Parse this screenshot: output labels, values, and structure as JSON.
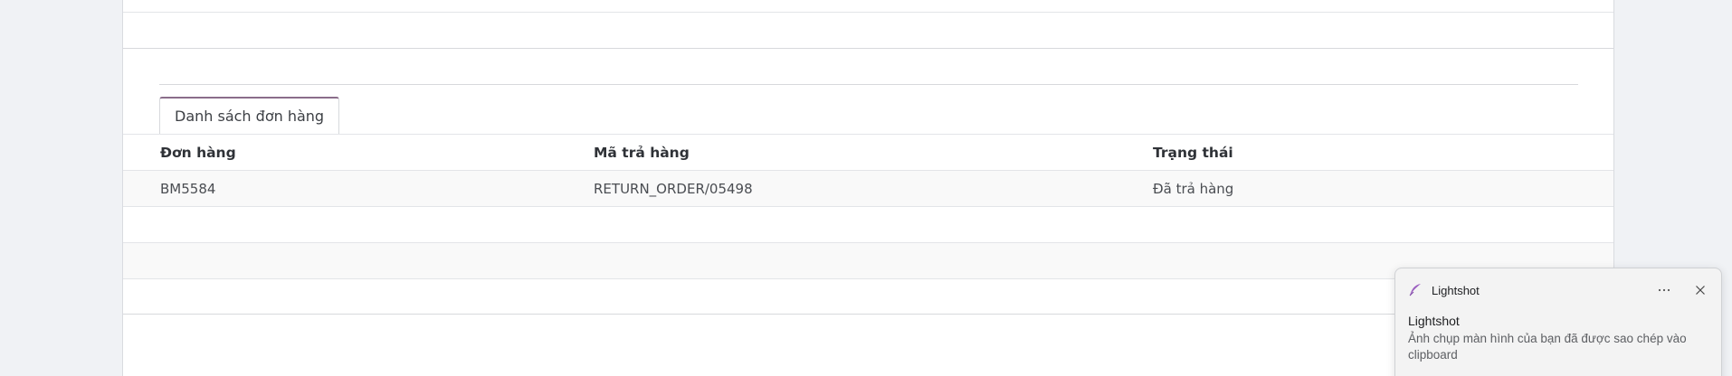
{
  "tabs": {
    "orders_tab": "Danh sách đơn hàng"
  },
  "table": {
    "headers": [
      "Đơn hàng",
      "Mã trả hàng",
      "Trạng thái"
    ],
    "rows": [
      [
        "BM5584",
        "RETURN_ORDER/05498",
        "Đã trả hàng"
      ]
    ]
  },
  "notification": {
    "app_name": "Lightshot",
    "title": "Lightshot",
    "message": "Ảnh chụp màn hình của bạn đã được sao chép vào clipboard",
    "more_icon": "ellipsis-icon",
    "close_icon": "close-icon",
    "accent_color": "#9b5fc0"
  },
  "colors": {
    "tab_accent": "#8a6d8a",
    "background": "#f0f2f5"
  }
}
